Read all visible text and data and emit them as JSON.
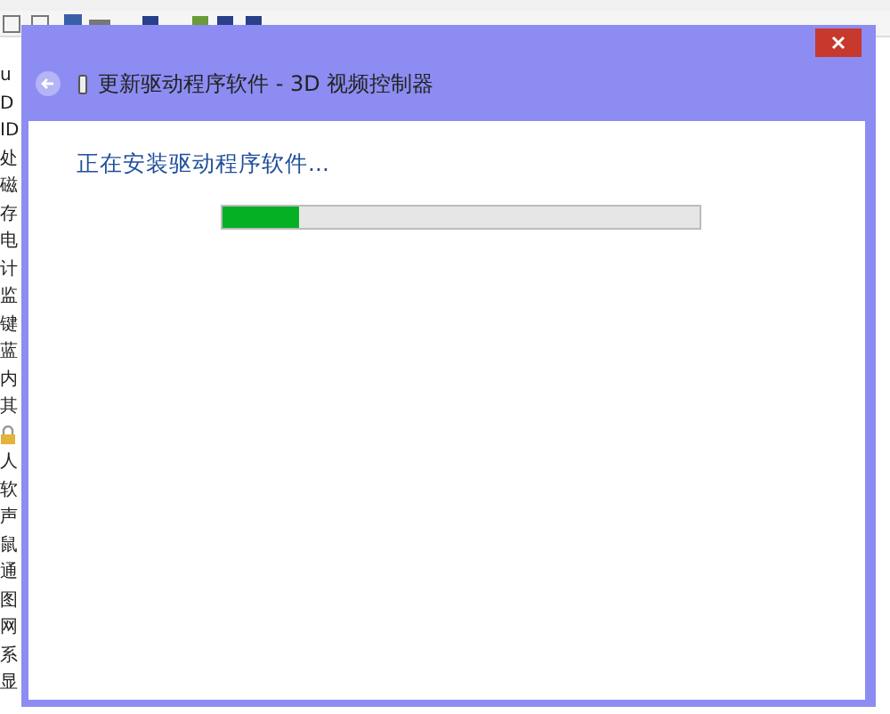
{
  "background_window": {
    "tree_items": [
      {
        "label": "u",
        "kind": "text"
      },
      {
        "label": "D",
        "kind": "text"
      },
      {
        "label": "ID",
        "kind": "text"
      },
      {
        "label": "处",
        "kind": "text"
      },
      {
        "label": "磁",
        "kind": "text"
      },
      {
        "label": "存",
        "kind": "text"
      },
      {
        "label": "电",
        "kind": "text"
      },
      {
        "label": "计",
        "kind": "text"
      },
      {
        "label": "监",
        "kind": "text"
      },
      {
        "label": "键",
        "kind": "text"
      },
      {
        "label": "蓝",
        "kind": "text"
      },
      {
        "label": "内",
        "kind": "text"
      },
      {
        "label": "其",
        "kind": "text"
      },
      {
        "kind": "lock"
      },
      {
        "label": "人",
        "kind": "text"
      },
      {
        "label": "软",
        "kind": "text"
      },
      {
        "label": "声",
        "kind": "text"
      },
      {
        "label": "鼠",
        "kind": "text"
      },
      {
        "label": "通",
        "kind": "text"
      },
      {
        "label": "图",
        "kind": "text"
      },
      {
        "label": "网",
        "kind": "text"
      },
      {
        "label": "系",
        "kind": "text"
      },
      {
        "label": "显",
        "kind": "text"
      }
    ]
  },
  "dialog": {
    "title": "更新驱动程序软件 - 3D 视频控制器",
    "heading": "正在安装驱动程序软件...",
    "progress": {
      "level": 0.16
    }
  }
}
